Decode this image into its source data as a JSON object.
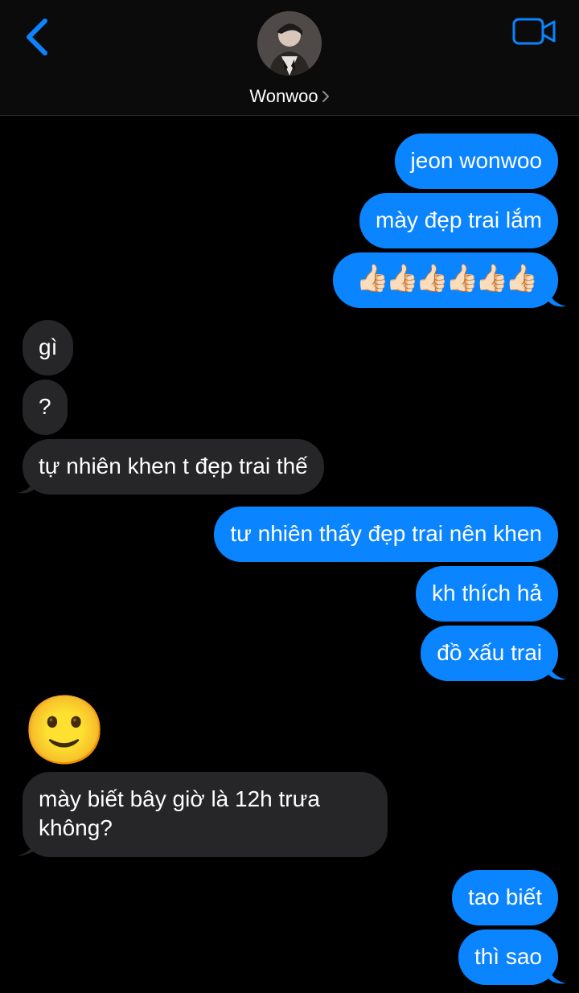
{
  "header": {
    "contact_name": "Wonwoo"
  },
  "messages": [
    {
      "from": "me",
      "text": "jeon wonwoo"
    },
    {
      "from": "me",
      "text": "mày đẹp trai lắm"
    },
    {
      "from": "me",
      "text": "👍🏻👍🏻👍🏻👍🏻👍🏻👍🏻"
    },
    {
      "from": "them",
      "text": "gì"
    },
    {
      "from": "them",
      "text": "?"
    },
    {
      "from": "them",
      "text": "tự nhiên khen t đẹp trai thế"
    },
    {
      "from": "me",
      "text": "tư nhiên thấy đẹp trai nên khen"
    },
    {
      "from": "me",
      "text": "kh thích hả"
    },
    {
      "from": "me",
      "text": "đồ xấu trai"
    },
    {
      "from": "them",
      "text": "🙂"
    },
    {
      "from": "them",
      "text_line1": "mày biết bây giờ là 12h trưa",
      "text_line2": "không?"
    },
    {
      "from": "me",
      "text": "tao biết"
    },
    {
      "from": "me",
      "text": "thì sao"
    }
  ],
  "colors": {
    "outgoing": "#0a84ff",
    "incoming": "#262628",
    "accent": "#0a84ff"
  }
}
